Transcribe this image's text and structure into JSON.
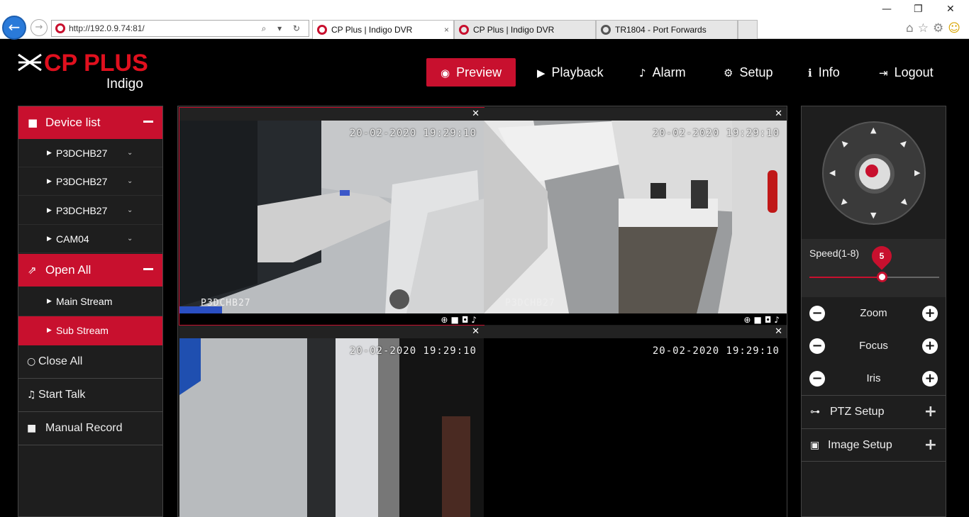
{
  "browser": {
    "url": "http://192.0.9.74:81/",
    "tabs": [
      {
        "title": "CP Plus | Indigo DVR",
        "close": "×"
      },
      {
        "title": "CP Plus | Indigo DVR"
      },
      {
        "title": "TR1804 - Port Forwards"
      }
    ],
    "window_controls": {
      "minimize": "—",
      "restore": "❐",
      "close": "✕"
    },
    "toolbar_icons": [
      "home-icon",
      "star-icon",
      "gear-icon",
      "smiley-icon"
    ]
  },
  "header": {
    "brand": "CP PLUS",
    "brand_sub": "Indigo",
    "nav": [
      {
        "label": "Preview",
        "icon": "eye-icon",
        "active": true
      },
      {
        "label": "Playback",
        "icon": "play-icon"
      },
      {
        "label": "Alarm",
        "icon": "bell-icon"
      },
      {
        "label": "Setup",
        "icon": "gear-icon"
      },
      {
        "label": "Info",
        "icon": "info-icon"
      },
      {
        "label": "Logout",
        "icon": "logout-icon"
      }
    ]
  },
  "left": {
    "device_list_label": "Device list",
    "devices": [
      "P3DCHB27",
      "P3DCHB27",
      "P3DCHB27",
      "CAM04"
    ],
    "open_all_label": "Open All",
    "streams": [
      {
        "label": "Main Stream",
        "selected": false
      },
      {
        "label": "Sub Stream",
        "selected": true
      }
    ],
    "close_all_label": "Close All",
    "start_talk_label": "Start Talk",
    "manual_record_label": "Manual Record"
  },
  "video": {
    "cells": [
      {
        "timestamp": "20-02-2020 19:29:10",
        "camera": "P3DCHB27",
        "active": true
      },
      {
        "timestamp": "20-02-2020 19:29:10",
        "camera": "P3DCHB27",
        "active": false
      },
      {
        "timestamp": "20-02-2020 19:29:10",
        "camera": "",
        "active": false
      },
      {
        "timestamp": "20-02-2020 19:29:10",
        "camera": "",
        "active": false
      }
    ]
  },
  "ptz": {
    "speed_label": "Speed(1-8)",
    "speed_value": "5",
    "speed_min": 1,
    "speed_max": 8,
    "zoom_label": "Zoom",
    "focus_label": "Focus",
    "iris_label": "Iris",
    "ptz_setup_label": "PTZ Setup",
    "image_setup_label": "Image Setup"
  },
  "colors": {
    "accent": "#c8102e",
    "background": "#000000",
    "panel": "#1e1e1e"
  }
}
